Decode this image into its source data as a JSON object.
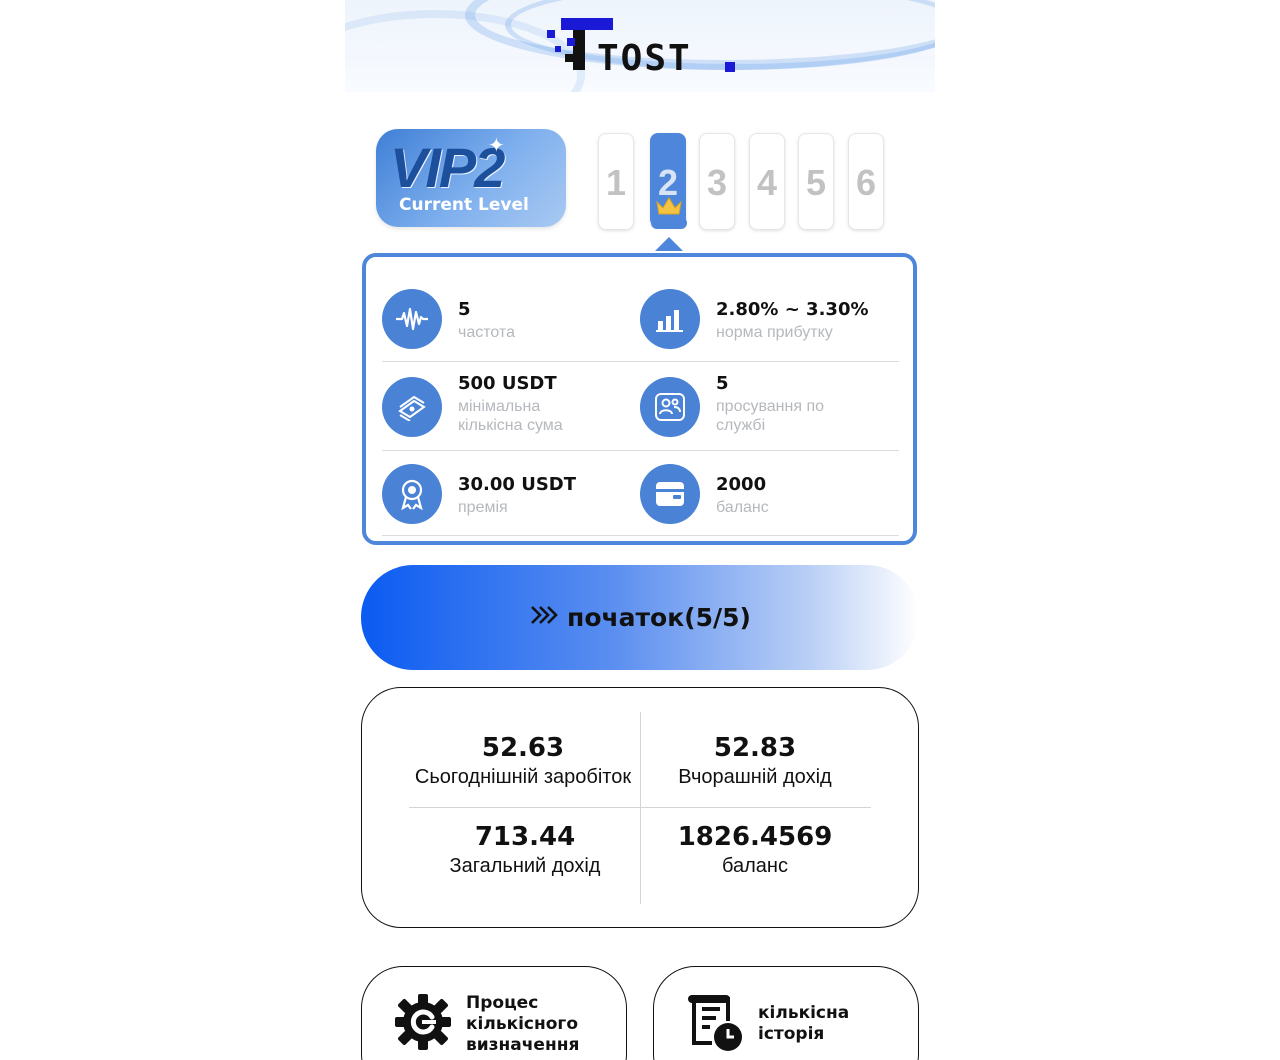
{
  "header": {
    "logo_text": "TOST"
  },
  "vip": {
    "title": "VIP2",
    "subtitle": "Current Level",
    "levels": [
      "1",
      "2",
      "3",
      "4",
      "5",
      "6"
    ],
    "active_level": "2"
  },
  "info": {
    "frequency": {
      "value": "5",
      "label": "частота",
      "icon": "waveform-icon"
    },
    "profit_rate": {
      "value": "2.80% ~ 3.30%",
      "label": "норма прибутку",
      "icon": "bar-chart-icon"
    },
    "min_amount": {
      "value": "500 USDT",
      "label": "мінімальна кількісна сума",
      "icon": "money-stack-icon"
    },
    "promotion": {
      "value": "5",
      "label": "просування по службі",
      "icon": "team-icon"
    },
    "bonus": {
      "value": "30.00 USDT",
      "label": "премія",
      "icon": "award-icon"
    },
    "balance": {
      "value": "2000",
      "label": "баланс",
      "icon": "wallet-icon"
    }
  },
  "start_button": {
    "label": "початок(5/5)",
    "icon": "double-chevron-right-icon"
  },
  "stats": {
    "today": {
      "value": "52.63",
      "label": "Сьогоднішній заробіток"
    },
    "yesterday": {
      "value": "52.83",
      "label": "Вчорашній дохід"
    },
    "total": {
      "value": "713.44",
      "label": "Загальний дохід"
    },
    "balance": {
      "value": "1826.4569",
      "label": "баланс"
    }
  },
  "bottom": {
    "process": {
      "label": "Процес кількісного визначення",
      "icon": "gear-icon"
    },
    "history": {
      "label": "кількісна історія",
      "icon": "history-document-icon"
    }
  },
  "colors": {
    "accent": "#4e86db",
    "button_start": "#0b5bf1",
    "muted_text": "#b5b8bd"
  }
}
